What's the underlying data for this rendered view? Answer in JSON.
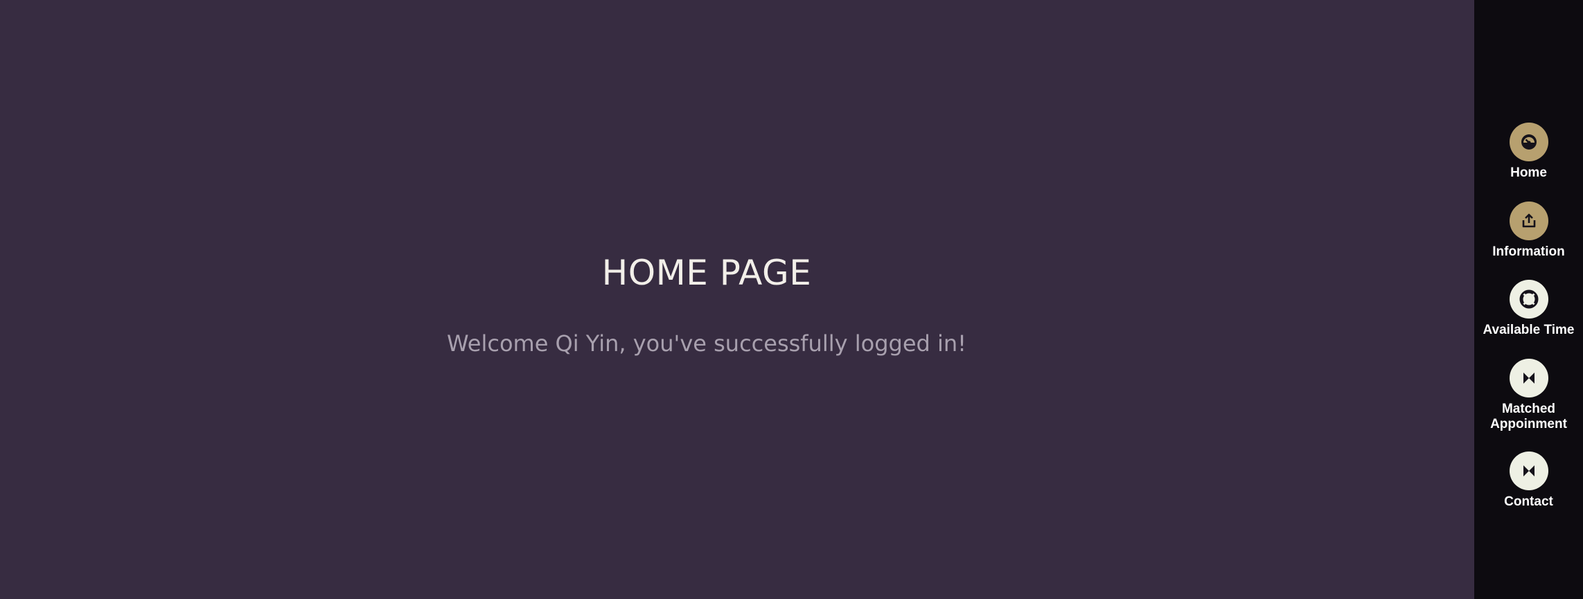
{
  "main": {
    "title": "HOME PAGE",
    "welcome": "Welcome Qi Yin, you've successfully logged in!"
  },
  "sidebar": {
    "items": [
      {
        "label": "Home",
        "icon": "dashboard-icon",
        "color": "#b7a06f"
      },
      {
        "label": "Information",
        "icon": "share-icon",
        "color": "#b7a06f"
      },
      {
        "label": "Available Time",
        "icon": "lifebuoy-icon",
        "color": "#eef0e4"
      },
      {
        "label": "Matched\nAppoinment",
        "icon": "bowtie-icon",
        "color": "#eef0e4"
      },
      {
        "label": "Contact",
        "icon": "bowtie-icon",
        "color": "#eef0e4"
      }
    ]
  },
  "colors": {
    "background": "#372c41",
    "sidebar": "#0d0b10",
    "title": "#f2efe9",
    "welcome": "#a8a0ae"
  }
}
